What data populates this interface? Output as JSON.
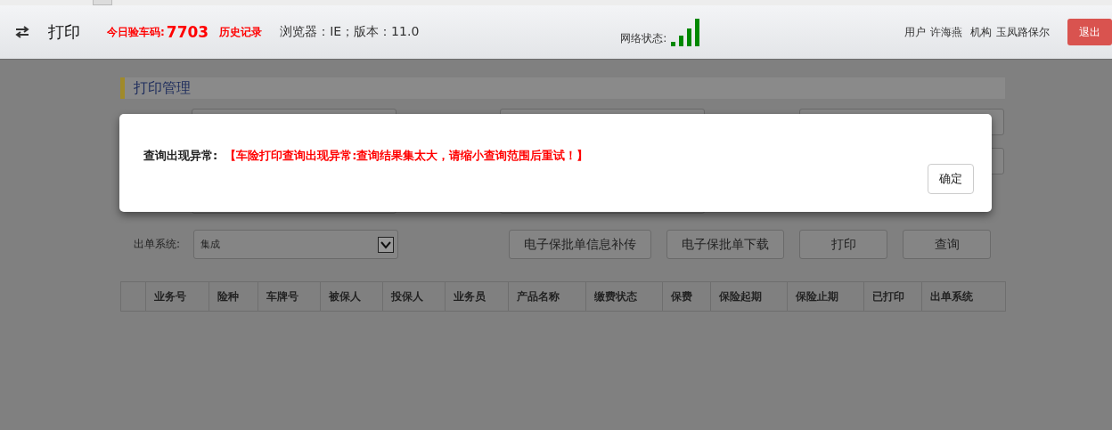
{
  "header": {
    "title": "打印",
    "code_label": "今日验车码:",
    "code": "7703",
    "history_link": "历史记录",
    "browser_info": "浏览器：IE；版本：11.0",
    "network_label": "网络状态:",
    "user_label": "用户",
    "user_name": "许海燕",
    "org_label": "机构",
    "org_name": "玉凤路保尔",
    "logout_button": "退出"
  },
  "section_title": "打印管理",
  "filter": {
    "label": "出单系统:",
    "select_value": "集成"
  },
  "buttons": [
    "电子保批单信息补传",
    "电子保批单下载",
    "打印",
    "查询"
  ],
  "table": {
    "columns": [
      "业务号",
      "险种",
      "车牌号",
      "被保人",
      "投保人",
      "业务员",
      "产品名称",
      "缴费状态",
      "保费",
      "保险起期",
      "保险止期",
      "已打印",
      "出单系统"
    ]
  },
  "dialog": {
    "label": "查询出现异常:",
    "message": "【车险打印查询出现异常:查询结果集太大，请缩小查询范围后重试！】",
    "ok_button": "确定"
  }
}
